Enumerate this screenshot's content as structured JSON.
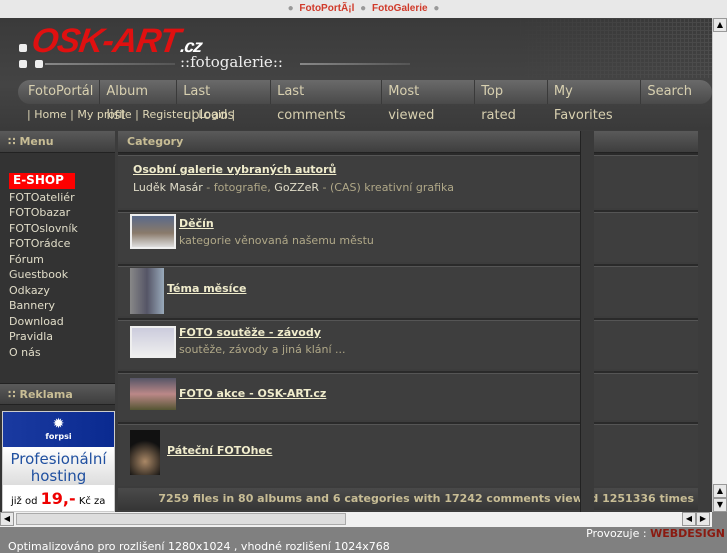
{
  "topbar": {
    "links": [
      "FotoPortÃ¡l",
      "FotoGalerie"
    ]
  },
  "header": {
    "logo": "OSK-ART",
    "logo_tld": ".cz",
    "subtitle": "::fotogalerie::"
  },
  "nav": [
    "FotoPortál",
    "Album list",
    "Last uploads",
    "Last comments",
    "Most viewed",
    "Top rated",
    "My Favorites",
    "Search"
  ],
  "userlinks": [
    "Home",
    "My profile",
    "Register",
    "Login"
  ],
  "sidebar": {
    "menu_title": "Menu",
    "items": [
      "E-SHOP",
      "FOTOateliér",
      "FOTObazar",
      "FOTOslovník",
      "FOTOrádce",
      "Fórum",
      "Guestbook",
      "Odkazy",
      "Bannery",
      "Download",
      "Pravidla",
      "O nás"
    ],
    "ad_title": "Reklama",
    "ad": {
      "brand": "forpsi",
      "headline1": "Profesionální",
      "headline2": "hosting",
      "price_prefix": "již od",
      "price": "19,-",
      "price_suffix": "Kč za"
    }
  },
  "main": {
    "header": "Category",
    "first": {
      "title": "Osobní galerie vybraných autorů",
      "links": [
        "Luděk Masár",
        "GoZZeR"
      ],
      "desc1": " - fotografie, ",
      "desc2": " - (CAS) kreativní grafika"
    },
    "rows": [
      {
        "title": "Děčín",
        "desc": "kategorie věnovaná našemu městu"
      },
      {
        "title": "Téma měsíce",
        "desc": ""
      },
      {
        "title": "FOTO soutěže - závody",
        "desc": "soutěže, závody a jiná klání ..."
      },
      {
        "title": "FOTO akce - OSK-ART.cz",
        "desc": ""
      },
      {
        "title": "Páteční FOTOhec",
        "desc": ""
      }
    ],
    "stats": "7259 files in 80 albums and 6 categories with 17242 comments viewed 1251336 times"
  },
  "bottom": {
    "operator_label": "Provozuje :",
    "operator": "WEBDESIGN",
    "note": "Optimalizováno pro rozlišení 1280x1024 , vhodné rozlišení 1024x768"
  }
}
